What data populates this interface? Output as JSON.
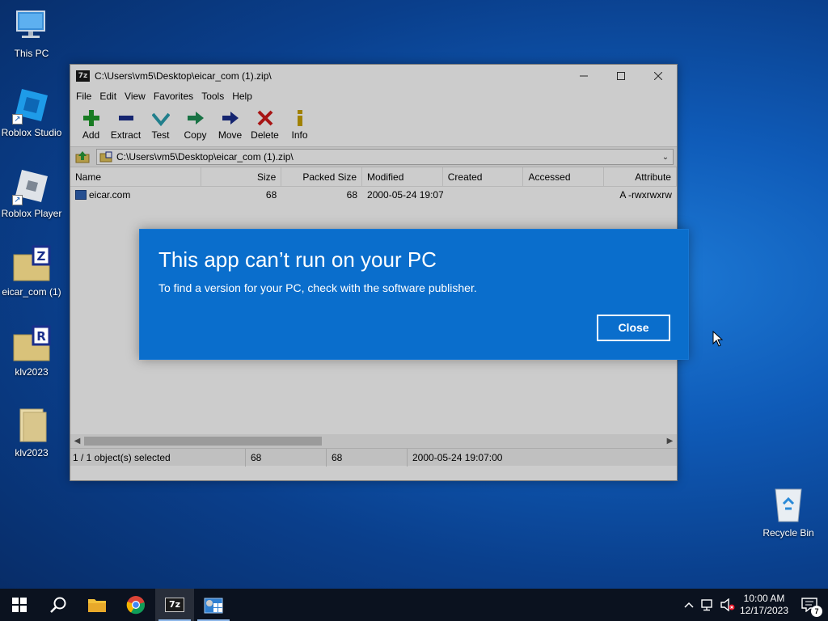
{
  "desktop": {
    "icons": [
      {
        "label": "This PC",
        "icon": "computer-icon"
      },
      {
        "label": "Roblox Studio",
        "icon": "roblox-studio-icon"
      },
      {
        "label": "Roblox Player",
        "icon": "roblox-player-icon"
      },
      {
        "label": "eicar_com (1)",
        "icon": "zip-archive-icon"
      },
      {
        "label": "klv2023",
        "icon": "rar-archive-icon"
      },
      {
        "label": "klv2023",
        "icon": "folder-icon"
      },
      {
        "label": "Recycle Bin",
        "icon": "recycle-bin-icon"
      }
    ]
  },
  "window": {
    "app_icon_text": "7z",
    "title": "C:\\Users\\vm5\\Desktop\\eicar_com (1).zip\\",
    "menu": [
      "File",
      "Edit",
      "View",
      "Favorites",
      "Tools",
      "Help"
    ],
    "toolbar": [
      {
        "label": "Add",
        "icon": "add-icon",
        "color": "#1f9a2b"
      },
      {
        "label": "Extract",
        "icon": "extract-icon",
        "color": "#1b2f8c"
      },
      {
        "label": "Test",
        "icon": "test-icon",
        "color": "#2a9fb0"
      },
      {
        "label": "Copy",
        "icon": "copy-icon",
        "color": "#1f8f55"
      },
      {
        "label": "Move",
        "icon": "move-icon",
        "color": "#1b2f8c"
      },
      {
        "label": "Delete",
        "icon": "delete-icon",
        "color": "#d11b1b"
      },
      {
        "label": "Info",
        "icon": "info-icon",
        "color": "#c9a200"
      }
    ],
    "address": "C:\\Users\\vm5\\Desktop\\eicar_com (1).zip\\",
    "columns": [
      "Name",
      "Size",
      "Packed Size",
      "Modified",
      "Created",
      "Accessed",
      "Attribute"
    ],
    "rows": [
      {
        "name": "eicar.com",
        "size": "68",
        "packed": "68",
        "modified": "2000-05-24 19:07",
        "created": "",
        "accessed": "",
        "attributes": "A -rwxrwxrw"
      }
    ],
    "status": {
      "selected": "1 / 1 object(s) selected",
      "size": "68",
      "packed": "68",
      "modified": "2000-05-24 19:07:00"
    }
  },
  "dialog": {
    "title": "This app can’t run on your PC",
    "message": "To find a version for your PC, check with the software publisher.",
    "close_label": "Close"
  },
  "taskbar": {
    "clock_time": "10:00 AM",
    "clock_date": "12/17/2023",
    "notification_count": "7"
  },
  "colors": {
    "dialog_bg": "#0a6ecc",
    "taskbar_bg": "#0b121f"
  }
}
